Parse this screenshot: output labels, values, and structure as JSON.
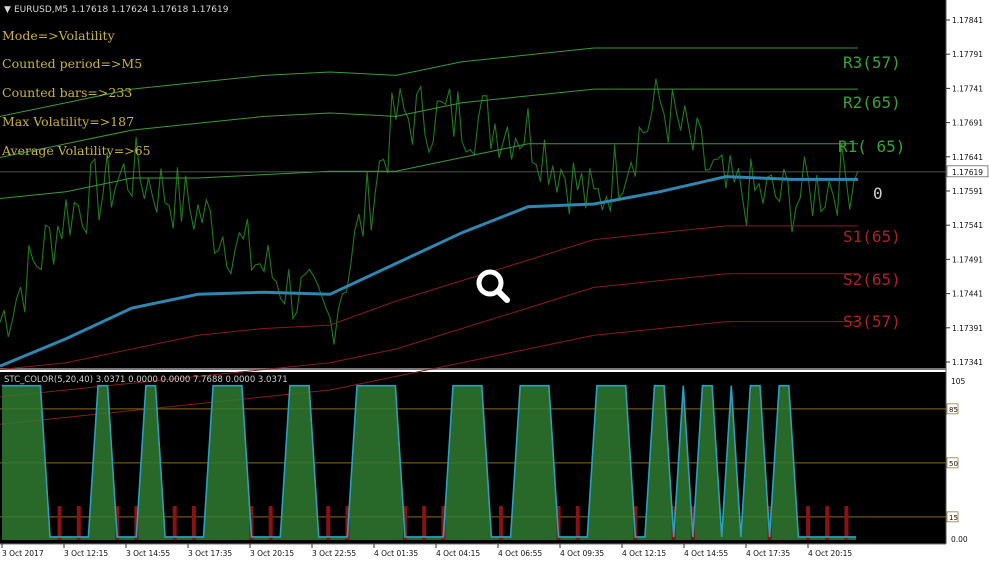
{
  "window": {
    "symbol_header": "EURUSD,M5  1.17618 1.17624 1.17618 1.17619"
  },
  "info_panel": {
    "lines": [
      "Mode=>Volatility",
      "Counted period=>M5",
      "Counted bars=>233",
      "Max Volatility=>187",
      "Average Volatility=>65"
    ]
  },
  "levels": {
    "r3": "R3(57)",
    "r2": "R2(65)",
    "r1": "R1( 65)",
    "pivot": "0",
    "s1": "S1(65)",
    "s2": "S2(65)",
    "s3": "S3(57)"
  },
  "colors": {
    "background": "#000000",
    "price": "#1f7a1f",
    "resistance_band": "#3a9a3a",
    "support_band": "#8a1a1a",
    "pivot_line": "#2f86b0",
    "pivot_flat": "#b8692a",
    "resistance_label": "#34a534",
    "support_label": "#b02020",
    "indicator_fill": "#2f7a2f",
    "indicator_line": "#2aa0c0",
    "indicator_red": "#8a1212",
    "level_line": "#8a6a1a"
  },
  "price_axis": {
    "ticks": [
      "1.17841",
      "1.17791",
      "1.17741",
      "1.17691",
      "1.17641",
      "1.17591",
      "1.17541",
      "1.17491",
      "1.17441",
      "1.17391",
      "1.17341"
    ],
    "current": "1.17619"
  },
  "indicator": {
    "header": "STC_COLOR(5,20,40) 3.0371 0.0000 0.0000 7.7688 0.0000 3.0371",
    "axis_top": "105",
    "axis_bottom": "0.00",
    "levels": [
      "85",
      "50",
      "15"
    ]
  },
  "time_axis": {
    "labels": [
      "3 Oct 2017",
      "3 Oct 12:15",
      "3 Oct 14:55",
      "3 Oct 17:35",
      "3 Oct 20:15",
      "3 Oct 22:55",
      "4 Oct 01:35",
      "4 Oct 04:15",
      "4 Oct 06:55",
      "4 Oct 09:35",
      "4 Oct 12:15",
      "4 Oct 14:55",
      "4 Oct 17:35",
      "4 Oct 20:15"
    ]
  },
  "overlay": {
    "icon": "zoom-magnifier-icon"
  },
  "chart_data": {
    "type": "line",
    "price_ylim": [
      1.17341,
      1.17841
    ],
    "indicator_ylim": [
      0,
      105
    ],
    "current_price": 1.17619,
    "indicator_levels": [
      85,
      50,
      15
    ],
    "x": [
      "3 Oct 2017",
      "3 Oct 12:15",
      "3 Oct 14:55",
      "3 Oct 17:35",
      "3 Oct 20:15",
      "3 Oct 22:55",
      "4 Oct 01:35",
      "4 Oct 04:15",
      "4 Oct 06:55",
      "4 Oct 09:35",
      "4 Oct 12:15",
      "4 Oct 14:55",
      "4 Oct 17:35",
      "4 Oct 20:15"
    ],
    "pivot": [
      1.17335,
      1.17375,
      1.1742,
      1.1744,
      1.17443,
      1.1744,
      1.17485,
      1.1753,
      1.17568,
      1.17572,
      1.1759,
      1.17612,
      1.17608,
      1.17608
    ],
    "price": [
      1.174,
      1.1756,
      1.1762,
      1.1756,
      1.1748,
      1.174,
      1.177,
      1.177,
      1.1768,
      1.1757,
      1.1772,
      1.1759,
      1.1758,
      1.1762
    ],
    "r1": [
      1.1758,
      1.1759,
      1.1761,
      1.1761,
      1.17615,
      1.1762,
      1.1762,
      1.1764,
      1.1766,
      1.1766,
      1.1766,
      1.1766,
      1.1766,
      1.1766
    ],
    "r2": [
      1.1764,
      1.1766,
      1.1768,
      1.1769,
      1.177,
      1.17705,
      1.177,
      1.1772,
      1.1773,
      1.1774,
      1.1774,
      1.1774,
      1.1774,
      1.1774
    ],
    "r3": [
      1.177,
      1.1772,
      1.1774,
      1.1775,
      1.1776,
      1.17765,
      1.1776,
      1.1778,
      1.1779,
      1.178,
      1.178,
      1.178,
      1.178,
      1.178
    ],
    "s1": [
      1.1733,
      1.1734,
      1.1736,
      1.1738,
      1.1739,
      1.17395,
      1.1743,
      1.1746,
      1.1749,
      1.1752,
      1.1753,
      1.1754,
      1.1754,
      1.1754
    ],
    "s2": [
      1.1729,
      1.173,
      1.1731,
      1.1732,
      1.1733,
      1.1734,
      1.1736,
      1.1739,
      1.1742,
      1.1745,
      1.1746,
      1.1747,
      1.1747,
      1.1747
    ],
    "s3": [
      1.1725,
      1.1726,
      1.1727,
      1.1728,
      1.1729,
      1.173,
      1.1732,
      1.1734,
      1.1736,
      1.1738,
      1.1739,
      1.174,
      1.174,
      1.174
    ],
    "stc": [
      [
        100,
        100,
        100,
        100,
        100,
        0,
        0,
        0,
        0,
        0,
        100,
        100,
        0,
        0,
        0,
        100,
        100,
        0,
        0,
        0,
        0,
        0,
        100,
        100,
        100,
        100,
        0,
        0,
        0,
        0
      ],
      [
        100,
        100,
        100,
        0,
        0,
        0,
        0,
        100,
        100,
        100,
        100,
        100,
        0,
        0,
        0,
        0,
        0,
        100,
        100,
        100,
        100,
        0,
        0,
        0,
        100,
        100,
        100,
        100,
        0,
        0
      ],
      [
        0,
        0,
        100,
        100,
        100,
        100,
        0,
        0,
        100,
        100,
        0,
        100,
        0,
        100,
        100,
        0,
        100,
        0,
        100,
        100,
        0,
        100,
        100,
        0,
        0,
        0,
        0,
        0,
        0,
        0
      ]
    ]
  }
}
